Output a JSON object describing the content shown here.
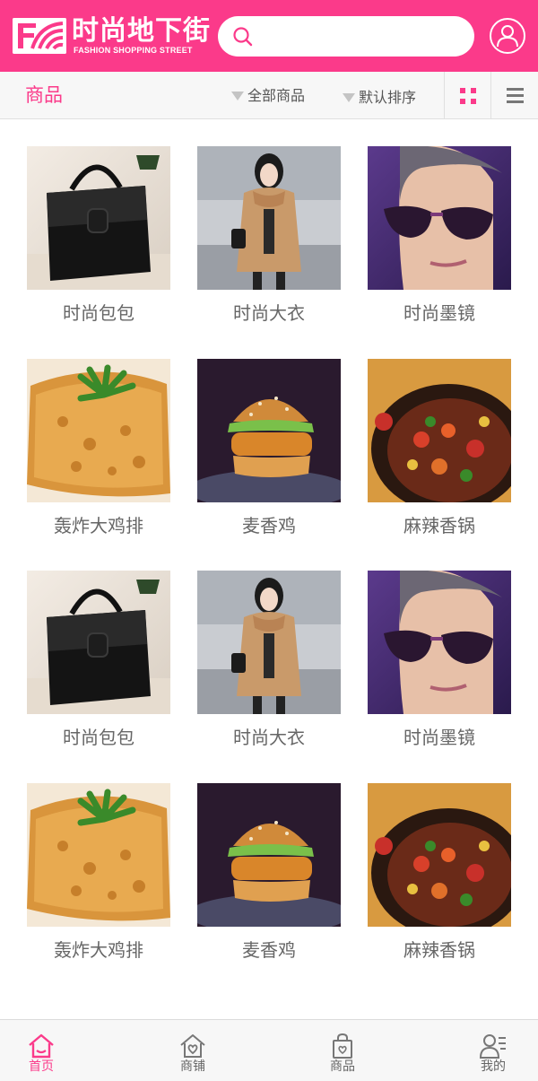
{
  "header": {
    "brand_cn": "时尚地下街",
    "brand_en": "FASHION SHOPPING STREET",
    "search_value": "",
    "search_placeholder": ""
  },
  "subbar": {
    "title": "商品",
    "filter_all": "全部商品",
    "filter_sort": "默认排序"
  },
  "products": [
    {
      "name": "时尚包包",
      "image": "black-handbag"
    },
    {
      "name": "时尚大衣",
      "image": "woman-camel-coat"
    },
    {
      "name": "时尚墨镜",
      "image": "woman-sunglasses"
    },
    {
      "name": "轰炸大鸡排",
      "image": "fried-chicken-cutlet"
    },
    {
      "name": "麦香鸡",
      "image": "chicken-burger"
    },
    {
      "name": "麻辣香锅",
      "image": "spicy-hot-pot"
    },
    {
      "name": "时尚包包",
      "image": "black-handbag"
    },
    {
      "name": "时尚大衣",
      "image": "woman-camel-coat"
    },
    {
      "name": "时尚墨镜",
      "image": "woman-sunglasses"
    },
    {
      "name": "轰炸大鸡排",
      "image": "fried-chicken-cutlet"
    },
    {
      "name": "麦香鸡",
      "image": "chicken-burger"
    },
    {
      "name": "麻辣香锅",
      "image": "spicy-hot-pot"
    }
  ],
  "bottom_nav": [
    {
      "label": "首页",
      "icon": "home-icon",
      "active": true
    },
    {
      "label": "商铺",
      "icon": "shop-icon",
      "active": false
    },
    {
      "label": "商品",
      "icon": "bag-icon",
      "active": false
    },
    {
      "label": "我的",
      "icon": "profile-icon",
      "active": false
    }
  ],
  "colors": {
    "brand_pink": "#fb3a8a",
    "text_gray": "#666666",
    "bar_bg": "#f7f7f7"
  }
}
